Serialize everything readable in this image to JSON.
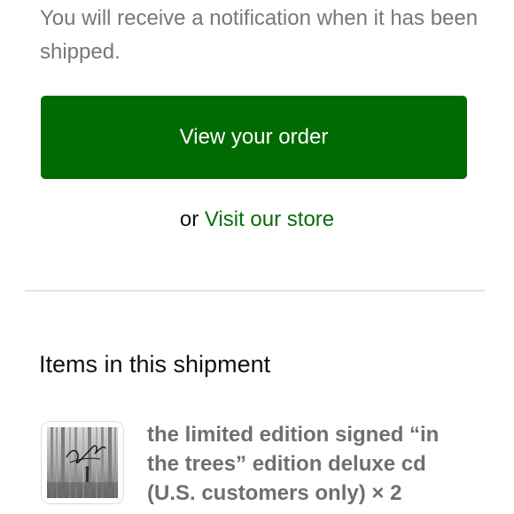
{
  "notice": {
    "text": "You will receive a notification when it has been shipped."
  },
  "actions": {
    "view_order_label": "View your order",
    "or_text": "or",
    "visit_store_label": "Visit our store"
  },
  "shipment": {
    "title": "Items in this shipment",
    "items": [
      {
        "title": "the limited edition signed “in the trees” edition deluxe cd (U.S. customers only)",
        "quantity_text": "× 2",
        "thumbnail": "album-cover-forest-image"
      }
    ]
  },
  "colors": {
    "accent": "#016a01",
    "link": "#0a6b0a",
    "muted_text": "#777777"
  }
}
